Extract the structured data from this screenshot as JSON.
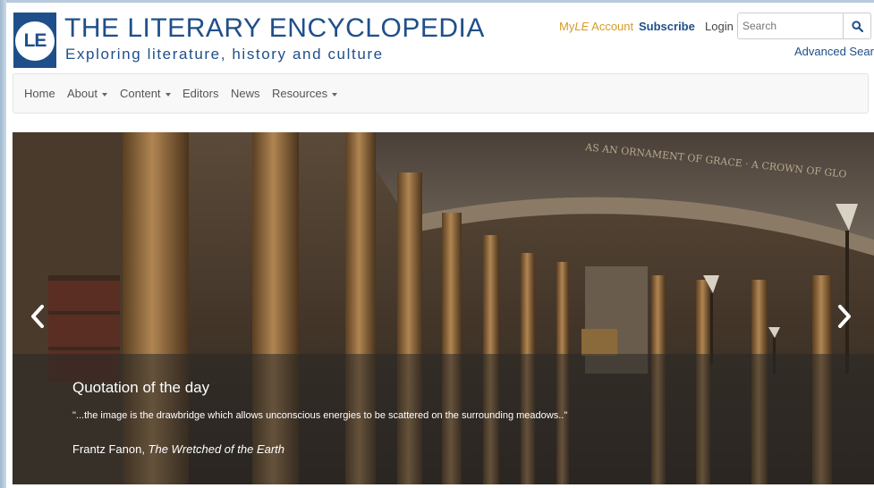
{
  "header": {
    "logo_text": "LE",
    "title": "THE LITERARY ENCYCLOPEDIA",
    "tagline": "Exploring literature, history and culture"
  },
  "top_links": {
    "myle_prefix": "My",
    "myle_italic": "LE",
    "myle_suffix": " Account",
    "subscribe": "Subscribe",
    "login": "Login"
  },
  "search": {
    "placeholder": "Search",
    "advanced": "Advanced Search"
  },
  "nav": {
    "items": [
      {
        "label": "Home",
        "dropdown": false
      },
      {
        "label": "About",
        "dropdown": true
      },
      {
        "label": "Content",
        "dropdown": true
      },
      {
        "label": "Editors",
        "dropdown": false
      },
      {
        "label": "News",
        "dropdown": false
      },
      {
        "label": "Resources",
        "dropdown": true
      }
    ]
  },
  "carousel": {
    "heading": "Quotation of the day",
    "quote": "\"...the image is the drawbridge which allows unconscious energies to be scattered on the surrounding meadows..\"",
    "author": "Frantz Fanon, ",
    "work": "The Wretched of the Earth",
    "inscription": "AS AN ORNAMENT OF GRACE · A CROWN OF GLO"
  },
  "colors": {
    "brand_blue": "#1f4f8a",
    "myle_gold": "#d79b2b"
  },
  "icons": {
    "search": "search-icon",
    "prev": "chevron-left-icon",
    "next": "chevron-right-icon"
  }
}
